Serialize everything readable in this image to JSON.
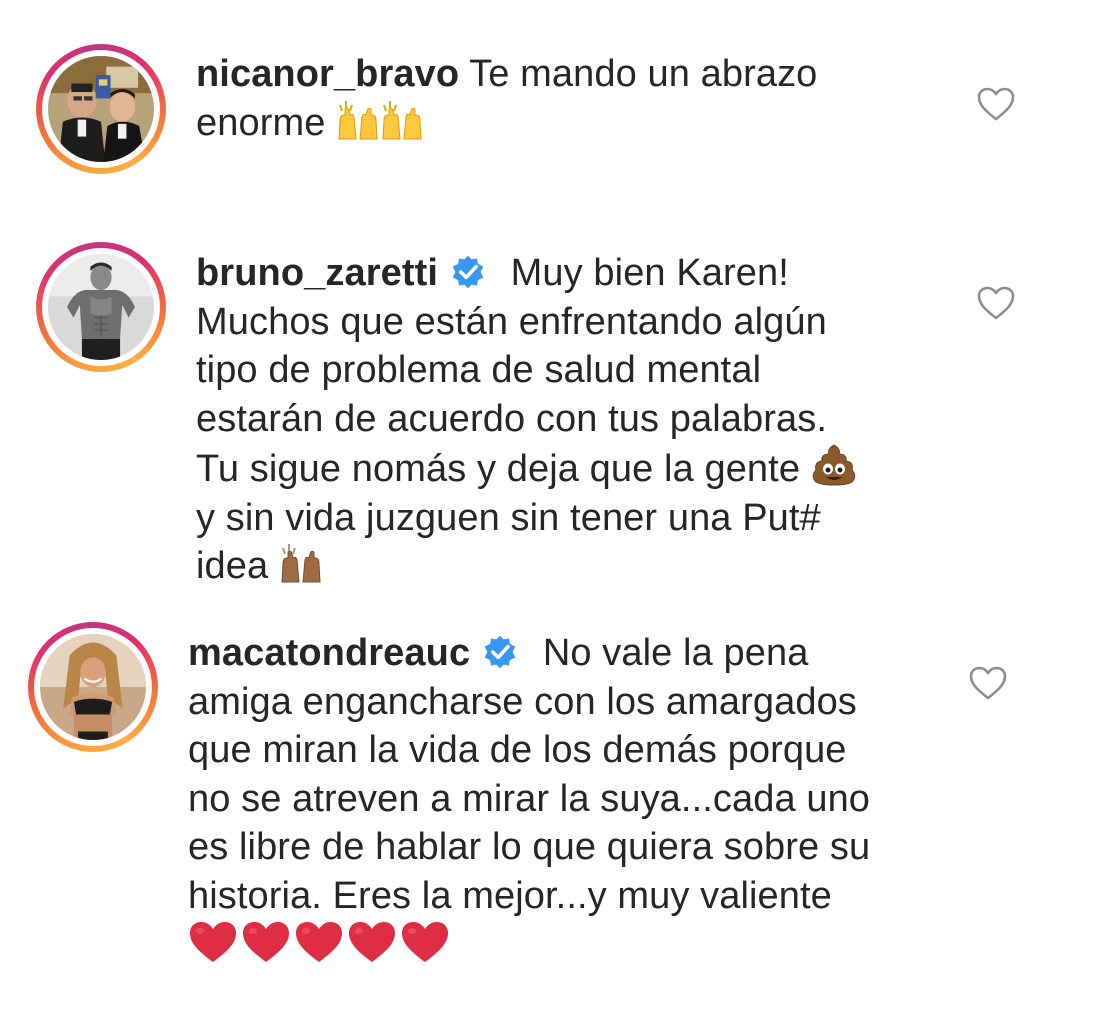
{
  "comments": [
    {
      "username": "nicanor_bravo",
      "verified": false,
      "lines": [
        "Te mando un abrazo",
        "enorme"
      ],
      "emojis": [
        "raising-hands",
        "raising-hands"
      ],
      "like_icon": "heart-outline-icon"
    },
    {
      "username": "bruno_zaretti",
      "verified": true,
      "lines": [
        "Muy bien Karen!",
        "Muchos que están enfrentando algún",
        "tipo de problema de salud mental",
        "estarán de acuerdo con tus palabras.",
        "Tu sigue nomás y deja que la gente",
        "y sin vida juzguen sin tener una Put#",
        "idea"
      ],
      "emojis": [
        "pile-of-poo",
        "raising-hands-medium-dark"
      ],
      "like_icon": "heart-outline-icon"
    },
    {
      "username": "macatondreauc",
      "verified": true,
      "lines": [
        "No vale la pena",
        "amiga engancharse con los amargados",
        "que miran la vida de los demás porque",
        "no se atreven a mirar la suya...cada uno",
        "es libre de hablar lo que quiera sobre su",
        "historia. Eres la mejor...y muy valiente"
      ],
      "emojis": [
        "red-heart",
        "red-heart",
        "red-heart",
        "red-heart",
        "red-heart"
      ],
      "like_icon": "heart-outline-icon"
    }
  ],
  "colors": {
    "text": "#262626",
    "verified_badge": "#3897f0",
    "heart_outline": "#8e8e8e",
    "story_ring": [
      "#f9a03c",
      "#e1306c",
      "#c13584"
    ]
  }
}
